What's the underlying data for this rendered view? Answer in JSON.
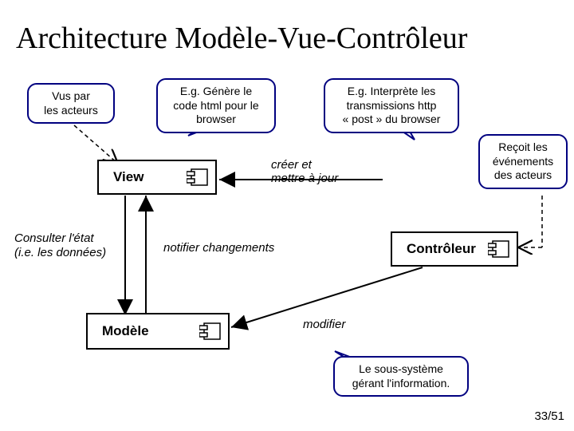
{
  "title": "Architecture Modèle-Vue-Contrôleur",
  "callouts": {
    "vus": "Vus par\nles acteurs",
    "genere": "E.g. Génère le\ncode html pour le\nbrowser",
    "interprete": "E.g. Interprète les\ntransmissions http\n« post » du browser",
    "recoit": "Reçoit les\névénements\ndes acteurs",
    "sous": "Le sous-système\ngérant l'information."
  },
  "boxes": {
    "view": "View",
    "controleur": "Contrôleur",
    "modele": "Modèle"
  },
  "notes": {
    "consulter": "Consulter l'état\n(i.e. les données)"
  },
  "labels": {
    "creer": "créer et\nmettre à jour",
    "notifier": "notifier changements",
    "modifier": "modifier"
  },
  "pagenum": "33/51"
}
